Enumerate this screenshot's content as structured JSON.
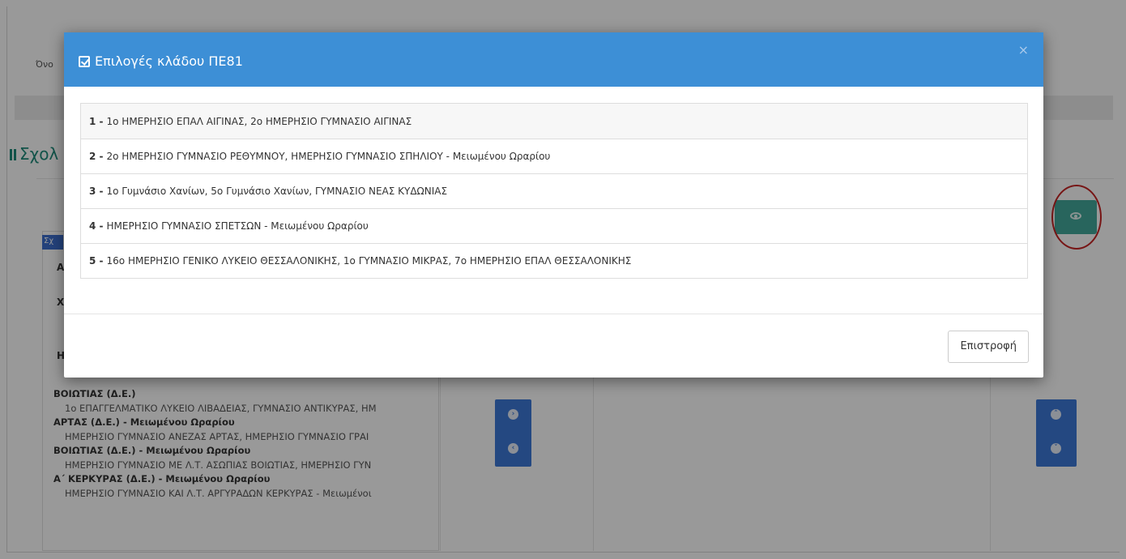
{
  "background": {
    "name_label": "Όνο",
    "section_title": "Σχολ",
    "tag_label": "Σχ",
    "left_letters": [
      "Α",
      "Χ",
      "Η"
    ],
    "school_groups": [
      {
        "title": "ΒΟΙΩΤΙΑΣ (Δ.Ε.)",
        "detail": "1ο ΕΠΑΓΓΕΛΜΑΤΙΚΟ ΛΥΚΕΙΟ ΛΙΒΑΔΕΙΑΣ, ΓΥΜΝΑΣΙΟ ΑΝΤΙΚΥΡΑΣ, ΗΜ"
      },
      {
        "title": "ΑΡΤΑΣ (Δ.Ε.) - Μειωμένου Ωραρίου",
        "detail": "ΗΜΕΡΗΣΙΟ ΓΥΜΝΑΣΙΟ ΑΝΕΖΑΣ ΑΡΤΑΣ, ΗΜΕΡΗΣΙΟ ΓΥΜΝΑΣΙΟ ΓΡΑΙ"
      },
      {
        "title": "ΒΟΙΩΤΙΑΣ (Δ.Ε.) - Μειωμένου Ωραρίου",
        "detail": "ΗΜΕΡΗΣΙΟ ΓΥΜΝΑΣΙΟ ΜΕ Λ.Τ. ΑΣΩΠΙΑΣ ΒΟΙΩΤΙΑΣ, ΗΜΕΡΗΣΙΟ ΓΥΝ"
      },
      {
        "title": "Α΄ ΚΕΡΚΥΡΑΣ (Δ.Ε.) - Μειωμένου Ωραρίου",
        "detail": "ΗΜΕΡΗΣΙΟ ΓΥΜΝΑΣΙΟ ΚΑΙ Λ.Τ. ΑΡΓΥΡΑΔΩΝ ΚΕΡΚΥΡΑΣ - Μειωμένοι"
      }
    ],
    "move_right_icon": "chevron-right-icon",
    "move_left_icon": "chevron-left-icon",
    "move_up_icon": "chevron-up-icon",
    "move_down_icon": "chevron-down-icon",
    "view_icon": "eye-icon"
  },
  "modal": {
    "title": "Επιλογές κλάδου ΠΕ81",
    "close_label": "×",
    "options": [
      {
        "num": "1 -",
        "text": "1ο ΗΜΕΡΗΣΙΟ ΕΠΑΛ ΑΙΓΙΝΑΣ, 2ο ΗΜΕΡΗΣΙΟ ΓΥΜΝΑΣΙΟ ΑΙΓΙΝΑΣ"
      },
      {
        "num": "2 -",
        "text": "2ο ΗΜΕΡΗΣΙΟ ΓΥΜΝΑΣΙΟ ΡΕΘΥΜΝΟΥ, ΗΜΕΡΗΣΙΟ ΓΥΜΝΑΣΙΟ ΣΠΗΛΙΟΥ - Μειωμένου Ωραρίου"
      },
      {
        "num": "3 -",
        "text": "1ο Γυμνάσιο Χανίων, 5ο Γυμνάσιο Χανίων, ΓΥΜΝΑΣΙΟ ΝΕΑΣ ΚΥΔΩΝΙΑΣ"
      },
      {
        "num": "4 -",
        "text": "ΗΜΕΡΗΣΙΟ ΓΥΜΝΑΣΙΟ ΣΠΕΤΣΩΝ - Μειωμένου Ωραρίου"
      },
      {
        "num": "5 -",
        "text": "16ο ΗΜΕΡΗΣΙΟ ΓΕΝΙΚΟ ΛΥΚΕΙΟ ΘΕΣΣΑΛΟΝΙΚΗΣ, 1ο ΓΥΜΝΑΣΙΟ ΜΙΚΡΑΣ, 7ο ΗΜΕΡΗΣΙΟ ΕΠΑΛ ΘΕΣΣΑΛΟΝΙΚΗΣ"
      }
    ],
    "return_label": "Επιστροφή"
  },
  "colors": {
    "modal_header": "#3d8fd6",
    "view_button": "#43a89c",
    "action_buttons": "#3c78d8",
    "highlight_circle": "#c72424",
    "section_title": "#1e8a7a"
  }
}
